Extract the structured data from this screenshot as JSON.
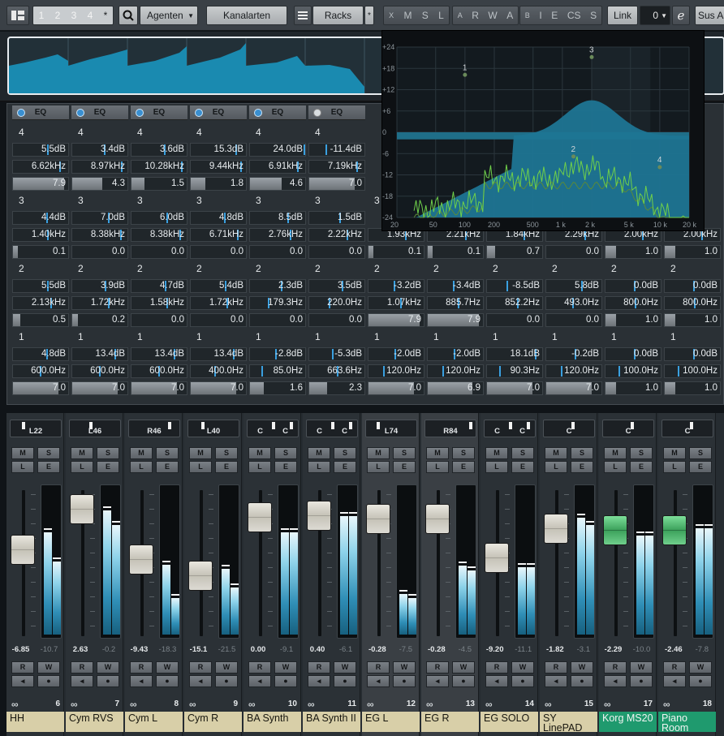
{
  "toolbar": {
    "visibility_tabs": [
      "1",
      "2",
      "3",
      "4",
      "*"
    ],
    "agents_label": "Agenten",
    "channel_types_label": "Kanalarten",
    "racks_label": "Racks",
    "racks_star": "*",
    "filter_x": "X",
    "filter_m": "M",
    "filter_s": "S",
    "filter_l": "L",
    "auto_a": "A",
    "auto_r": "R",
    "auto_w": "W",
    "auto_a2": "A",
    "bypass_b": "B",
    "bypass_i": "I",
    "bypass_e": "E",
    "bypass_cs": "CS",
    "bypass_s": "S",
    "link_label": "Link",
    "link_value": "0",
    "sus_label": "Sus Al"
  },
  "eq_graph": {
    "y_labels": [
      "+24",
      "+18",
      "+12",
      "+6",
      "0",
      "-6",
      "-12",
      "-18",
      "-24"
    ],
    "x_labels": [
      "20",
      "50",
      "100",
      "200",
      "500",
      "1 k",
      "2 k",
      "5 k",
      "10 k",
      "20 k"
    ],
    "band_points": [
      "1",
      "2",
      "3",
      "4"
    ]
  },
  "eq_header": "EQ",
  "channels": [
    {
      "band4": [
        "5.5dB",
        "6.62kHz",
        "7.9"
      ],
      "band3": [
        "4.4dB",
        "1.40kHz",
        "0.1"
      ],
      "band2": [
        "5.5dB",
        "2.13kHz",
        "0.5"
      ],
      "band1": [
        "4.8dB",
        "600.0Hz",
        "7.0"
      ],
      "pan": [
        "L22"
      ],
      "values": [
        "-6.85",
        "-10.7"
      ],
      "number": "6",
      "name": "HH",
      "color": "#d8cfa8"
    },
    {
      "band4": [
        "3.4dB",
        "8.97kHz",
        "4.3"
      ],
      "band3": [
        "7.0dB",
        "8.38kHz",
        "0.0"
      ],
      "band2": [
        "3.9dB",
        "1.72kHz",
        "0.2"
      ],
      "band1": [
        "13.4dB",
        "600.0Hz",
        "7.0"
      ],
      "pan": [
        "L46"
      ],
      "values": [
        "2.63",
        "-0.2"
      ],
      "number": "7",
      "name": "Cym RVS",
      "color": "#d8cfa8"
    },
    {
      "band4": [
        "3.6dB",
        "10.28kHz",
        "1.5"
      ],
      "band3": [
        "6.0dB",
        "8.38kHz",
        "0.0"
      ],
      "band2": [
        "4.7dB",
        "1.58kHz",
        "0.0"
      ],
      "band1": [
        "13.4dB",
        "600.0Hz",
        "7.0"
      ],
      "pan": [
        "R46"
      ],
      "values": [
        "-9.43",
        "-18.3"
      ],
      "number": "8",
      "name": "Cym L",
      "color": "#d8cfa8"
    },
    {
      "band4": [
        "15.3dB",
        "9.44kHz",
        "1.8"
      ],
      "band3": [
        "4.8dB",
        "6.71kHz",
        "0.0"
      ],
      "band2": [
        "5.4dB",
        "1.72kHz",
        "0.0"
      ],
      "band1": [
        "13.4dB",
        "400.0Hz",
        "7.0"
      ],
      "pan": [
        "L40"
      ],
      "values": [
        "-15.1",
        "-21.5"
      ],
      "number": "9",
      "name": "Cym R",
      "color": "#d8cfa8"
    },
    {
      "band4": [
        "24.0dB",
        "6.91kHz",
        "4.6"
      ],
      "band3": [
        "8.5dB",
        "2.76kHz",
        "0.0"
      ],
      "band2": [
        "2.3dB",
        "179.3Hz",
        "0.0"
      ],
      "band1": [
        "-2.8dB",
        "85.0Hz",
        "1.6"
      ],
      "pan": [
        "C",
        "C"
      ],
      "values": [
        "0.00",
        "-9.1"
      ],
      "number": "10",
      "name": "BA Synth",
      "color": "#d8cfa8"
    },
    {
      "band4": [
        "-11.4dB",
        "7.19kHz",
        "7.0"
      ],
      "band3": [
        "1.5dB",
        "2.22kHz",
        "0.0"
      ],
      "band2": [
        "3.5dB",
        "220.0Hz",
        "0.0"
      ],
      "band1": [
        "-5.3dB",
        "663.6Hz",
        "2.3"
      ],
      "pan": [
        "C",
        "C"
      ],
      "values": [
        "0.40",
        "-6.1"
      ],
      "number": "11",
      "name": "BA Synth II",
      "color": "#d8cfa8"
    },
    {
      "band4": [
        "",
        "",
        ""
      ],
      "band3": [
        "",
        "1.93kHz",
        "0.1"
      ],
      "band2": [
        "-3.2dB",
        "1.07kHz",
        "7.9"
      ],
      "band1": [
        "-2.0dB",
        "120.0Hz",
        "7.0"
      ],
      "pan": [
        "L74"
      ],
      "values": [
        "-0.28",
        "-7.5"
      ],
      "number": "12",
      "name": "EG L",
      "color": "#d8cfa8"
    },
    {
      "band4": [
        "",
        "",
        ""
      ],
      "band3": [
        "",
        "2.21kHz",
        "0.1"
      ],
      "band2": [
        "-3.4dB",
        "885.7Hz",
        "7.9"
      ],
      "band1": [
        "-2.0dB",
        "120.0Hz",
        "6.9"
      ],
      "pan": [
        "R84"
      ],
      "values": [
        "-0.28",
        "-4.5"
      ],
      "number": "13",
      "name": "EG R",
      "color": "#d8cfa8"
    },
    {
      "band4": [
        "",
        "",
        ""
      ],
      "band3": [
        "",
        "1.84kHz",
        "0.7"
      ],
      "band2": [
        "-8.5dB",
        "852.2Hz",
        "0.0"
      ],
      "band1": [
        "18.1dB",
        "90.3Hz",
        "7.0"
      ],
      "pan": [
        "C",
        "C"
      ],
      "values": [
        "-9.20",
        "-11.1"
      ],
      "number": "14",
      "name": "EG SOLO",
      "color": "#d8cfa8"
    },
    {
      "band4": [
        "",
        "",
        ""
      ],
      "band3": [
        "",
        "2.29kHz",
        "0.0"
      ],
      "band2": [
        "5.8dB",
        "493.0Hz",
        "0.0"
      ],
      "band1": [
        "-0.2dB",
        "120.0Hz",
        "7.0"
      ],
      "pan": [
        "C"
      ],
      "values": [
        "-1.82",
        "-3.1"
      ],
      "number": "15",
      "name": "SY LinePAD",
      "color": "#d8cfa8"
    },
    {
      "band4": [
        "",
        "",
        ""
      ],
      "band3": [
        "",
        "2.00kHz",
        "1.0"
      ],
      "band2": [
        "0.0dB",
        "800.0Hz",
        "1.0"
      ],
      "band1": [
        "0.0dB",
        "100.0Hz",
        "1.0"
      ],
      "pan": [
        "C"
      ],
      "values": [
        "-2.29",
        "-10.0"
      ],
      "number": "17",
      "name": "Korg MS20",
      "color": "#1f9a6e"
    },
    {
      "band4": [
        "",
        "",
        ""
      ],
      "band3": [
        "",
        "2.00kHz",
        "1.0"
      ],
      "band2": [
        "0.0dB",
        "800.0Hz",
        "1.0"
      ],
      "band1": [
        "0.0dB",
        "100.0Hz",
        "1.0"
      ],
      "pan": [
        "C"
      ],
      "values": [
        "-2.46",
        "-7.8"
      ],
      "number": "18",
      "name": "Piano Room",
      "color": "#1f9a6e"
    }
  ],
  "buttons": {
    "mute": "M",
    "solo": "S",
    "listen": "L",
    "edit": "E",
    "read": "R",
    "write": "W"
  }
}
